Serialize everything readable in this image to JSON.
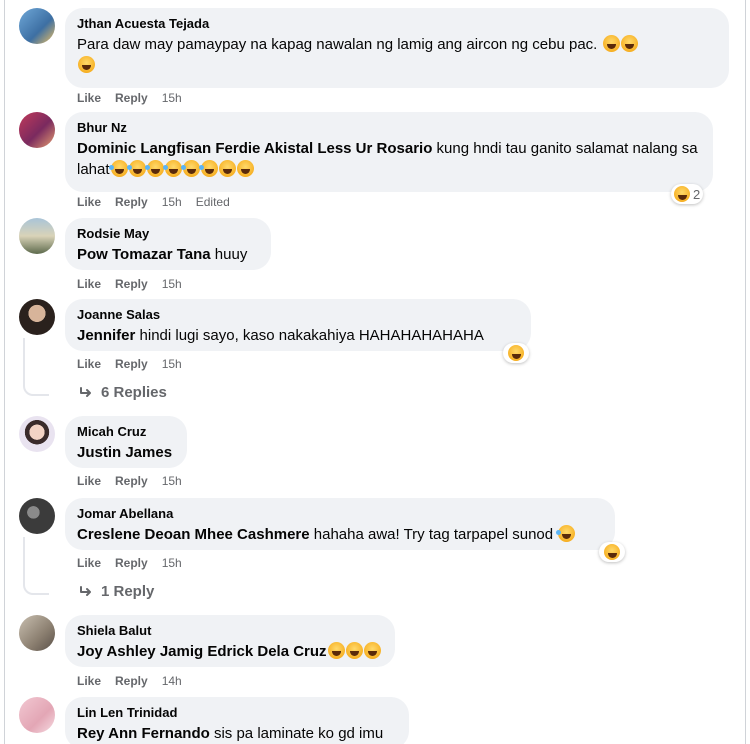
{
  "comments": [
    {
      "author": "Jthan Acuesta Tejada",
      "text": "Para daw may pamaypay na kapag nawalan ng lamig ang aircon ng cebu pac.",
      "actions": {
        "like": "Like",
        "reply": "Reply",
        "time": "15h"
      }
    },
    {
      "author": "Bhur Nz",
      "mention": "Dominic Langfisan Ferdie Akistal Less Ur Rosario",
      "text": " kung hndi tau ganito salamat nalang sa lahat",
      "reaction_count": "2",
      "actions": {
        "like": "Like",
        "reply": "Reply",
        "time": "15h",
        "edited": "Edited"
      }
    },
    {
      "author": "Rodsie May",
      "mention": "Pow Tomazar Tana",
      "text": " huuy",
      "actions": {
        "like": "Like",
        "reply": "Reply",
        "time": "15h"
      }
    },
    {
      "author": "Joanne Salas",
      "mention": "Jennifer",
      "text": " hindi lugi sayo, kaso nakakahiya HAHAHAHAHAHA",
      "actions": {
        "like": "Like",
        "reply": "Reply",
        "time": "15h"
      },
      "replies": "6 Replies"
    },
    {
      "author": "Micah Cruz",
      "mention": "Justin James",
      "text": "",
      "actions": {
        "like": "Like",
        "reply": "Reply",
        "time": "15h"
      }
    },
    {
      "author": "Jomar Abellana",
      "mention": "Creslene Deoan Mhee Cashmere",
      "text": " hahaha awa! Try tag tarpapel sunod",
      "actions": {
        "like": "Like",
        "reply": "Reply",
        "time": "15h"
      },
      "replies": "1 Reply"
    },
    {
      "author": "Shiela Balut",
      "mention": "Joy Ashley Jamig Edrick Dela Cruz",
      "text": "",
      "actions": {
        "like": "Like",
        "reply": "Reply",
        "time": "14h"
      }
    },
    {
      "author": "Lin Len Trinidad",
      "mention": "Rey Ann Fernando",
      "text": " sis pa laminate ko gd imu"
    }
  ],
  "icons": {
    "reaction": "laughing-emoji-icon",
    "reply_arrow": "reply-arrow-icon"
  },
  "colors": {
    "bubble": "#f0f2f5",
    "meta": "#65676b",
    "text": "#050505"
  }
}
